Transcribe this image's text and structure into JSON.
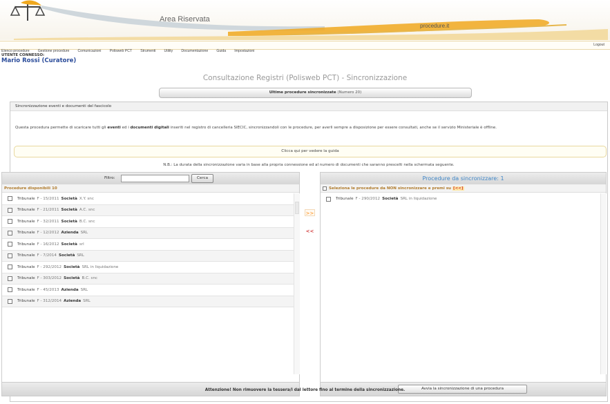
{
  "header": {
    "area_title": "Area Riservata",
    "logo_text": "procedure.it"
  },
  "menu": {
    "items": [
      "Elenco procedure",
      "Gestione procedure",
      "Comunicazioni",
      "Polisweb PCT",
      "Strumenti",
      "Utility",
      "Documentazione",
      "Guida",
      "Impostazioni"
    ],
    "login": "Logout"
  },
  "user": {
    "label": "UTENTE CONNESSO:",
    "name": "Mario Rossi (Curatore)"
  },
  "page": {
    "title": "Consultazione Registri (Polisweb PCT) - Sincronizzazione",
    "last_sync_label": "Ultime procedure sincronizzate",
    "last_sync_count": "(Numero 20)"
  },
  "section": {
    "header": "Sincronizzazione eventi e documenti del fascicolo",
    "description_before": "Questa procedura permette di scaricare tutti gli ",
    "description_eventi": "eventi",
    "description_mid": " ed i ",
    "description_docs": "documenti digitali",
    "description_after": " inseriti nel registro di cancelleria SIECIC, sincronizzandoli con le procedure, per averli sempre a disposizione per essere consultati, anche se il servizio Ministeriale è offline.",
    "guide_button": "Clicca qui per vedere la guida",
    "note": "N.B.: La durata della sincronizzazione varia in base alla propria connessione ed al numero di documenti che saranno prescelti nella schermata seguente."
  },
  "left": {
    "filter_label": "Filtro:",
    "filter_value": "",
    "search_button": "Cerca",
    "available_header": "Procedure disponibili 10",
    "items": [
      {
        "tribunal": "Tribunale",
        "number": "F - 15/2011",
        "kind": "Società",
        "rest": "X.Y. snc"
      },
      {
        "tribunal": "Tribunale",
        "number": "F - 21/2011",
        "kind": "Società",
        "rest": "A.C. snc"
      },
      {
        "tribunal": "Tribunale",
        "number": "F - 32/2011",
        "kind": "Società",
        "rest": "B.C. snc"
      },
      {
        "tribunal": "Tribunale",
        "number": "F - 12/2012",
        "kind": "Azienda",
        "rest": "SRL"
      },
      {
        "tribunal": "Tribunale",
        "number": "F - 16/2012",
        "kind": "Società",
        "rest": "srl"
      },
      {
        "tribunal": "Tribunale",
        "number": "F - 7/2014",
        "kind": "Società",
        "rest": "SRL"
      },
      {
        "tribunal": "Tribunale",
        "number": "F - 292/2012",
        "kind": "Società",
        "rest": "SRL in liquidazione"
      },
      {
        "tribunal": "Tribunale",
        "number": "F - 303/2012",
        "kind": "Società",
        "rest": "B.C. snc"
      },
      {
        "tribunal": "Tribunale",
        "number": "F - 45/2013",
        "kind": "Azienda",
        "rest": "SRL"
      },
      {
        "tribunal": "Tribunale",
        "number": "F - 312/2014",
        "kind": "Azienda",
        "rest": "SRL"
      }
    ]
  },
  "transfer": {
    "add": ">>",
    "remove": "<<"
  },
  "right": {
    "title": "Procedure da sincronizzare: 1",
    "select_all": "Seleziona le procedure da NON sincronizzare e premi su",
    "select_all_action": "[<<]",
    "items": [
      {
        "tribunal": "Tribunale",
        "number": "F - 290/2012",
        "kind": "Società",
        "rest": "SRL in liquidazione"
      }
    ],
    "start_button": "Avvia la sincronizzazione di una procedura"
  },
  "warning": "Attenzione! Non rimuovere la tessera/i dal lettore fino al termine della sincronizzazione."
}
